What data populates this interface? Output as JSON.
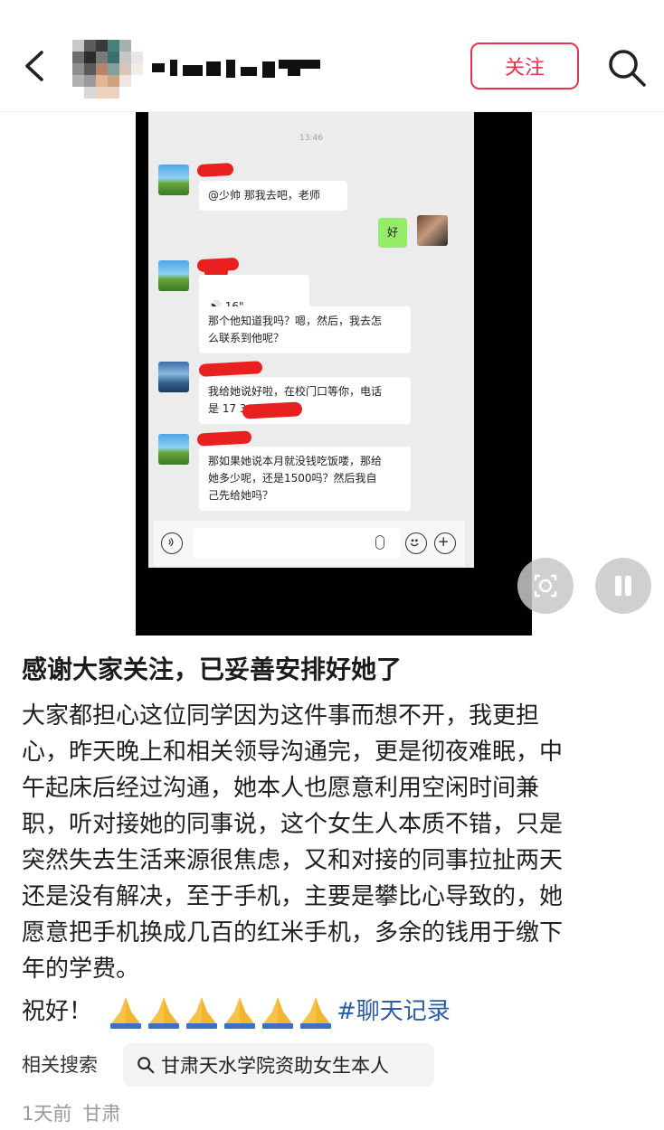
{
  "header": {
    "follow_label": "关注"
  },
  "media": {
    "chat_time": "13:46",
    "messages": [
      {
        "text": "@少帅  那我去吧，老师"
      },
      {
        "text": "好"
      },
      {
        "text": "16\""
      },
      {
        "text": "那个他知道我吗？嗯，然后，我去怎\n么联系到他呢？"
      },
      {
        "text": "我给她说好啦，在校门口等你，电话\n是 17            3"
      },
      {
        "text": "那如果她说本月就没钱吃饭喽，那给\n她多少呢，还是1500吗？然后我自\n己先给她吗？"
      }
    ]
  },
  "post": {
    "title": "感谢大家关注，已妥善安排好她了",
    "body": "大家都担心这位同学因为这件事而想不开，我更担\n心，昨天晚上和相关领导沟通完，更是彻夜难眠，中\n午起床后经过沟通，她本人也愿意利用空闲时间兼\n职，听对接她的同事说，这个女生人本质不错，只是\n突然失去生活来源很焦虑，又和对接的同事拉扯两天\n还是没有解决，至于手机，主要是攀比心导致的，她\n愿意把手机换成几百的红米手机，多余的钱用于缴下\n年的学费。",
    "sign_off": "祝好！",
    "emoji": "🙏",
    "hashtag": "#聊天记录"
  },
  "related": {
    "label": "相关搜索",
    "query": "甘肃天水学院资助女生本人"
  },
  "meta": {
    "time": "1天前",
    "location": "甘肃"
  },
  "colors": {
    "accent": "#e8334f",
    "hashtag": "#2b5ca8",
    "chat_green": "#95ec69",
    "redaction": "#e82020"
  },
  "icons": [
    "back-arrow-icon",
    "search-icon",
    "screenshot-icon",
    "pause-icon",
    "voice-icon",
    "emoji-icon",
    "add-icon",
    "pray-icon"
  ]
}
